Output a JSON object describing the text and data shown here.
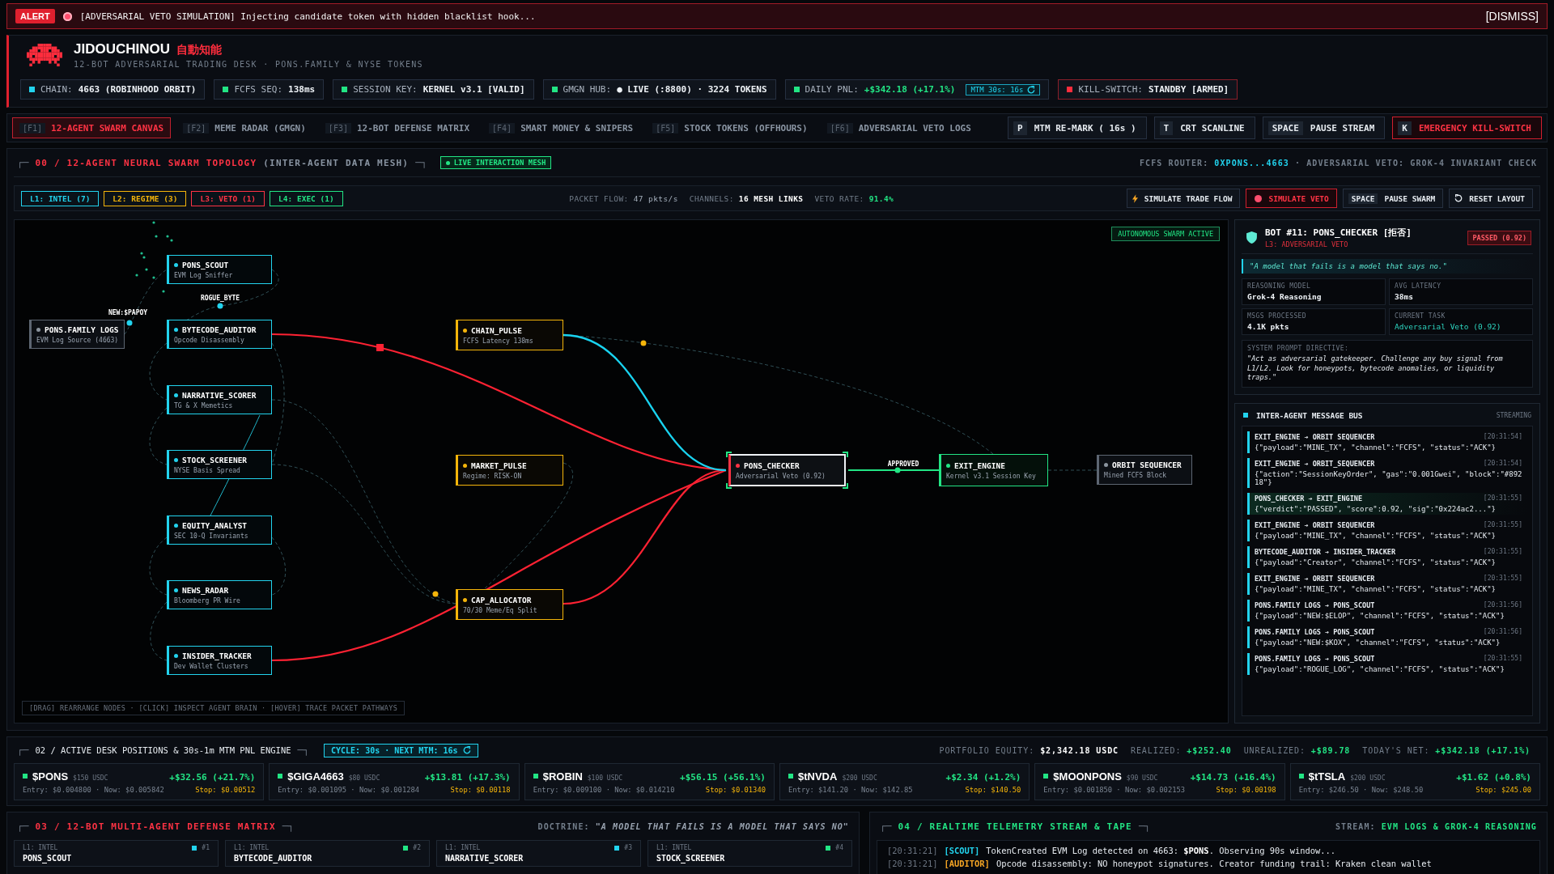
{
  "alert": {
    "badge": "ALERT",
    "message": "[ADVERSARIAL VETO SIMULATION] Injecting candidate token with hidden blacklist hook...",
    "dismiss": "[DISMISS]"
  },
  "header": {
    "brand": "JIDOUCHINOU",
    "brand_jp": "自動知能",
    "subtitle": "12-BOT ADVERSARIAL TRADING DESK · PONS.FAMILY & NYSE TOKENS",
    "status": [
      {
        "kind": "status",
        "label": "CHAIN:",
        "value": "4663 (ROBINHOOD ORBIT)",
        "color": "#22d3ee"
      },
      {
        "kind": "status",
        "label": "FCFS SEQ:",
        "value": "138ms",
        "color": "#22e584"
      },
      {
        "kind": "status",
        "label": "SESSION KEY:",
        "value": "KERNEL v3.1 [VALID]",
        "color": "#22e584"
      },
      {
        "kind": "status",
        "label": "GMGN HUB:",
        "value": "● LIVE (:8800) · 3224 TOKENS",
        "color": "#22e584"
      },
      {
        "kind": "pnl",
        "label": "DAILY PNL:",
        "value": "+$342.18 (+17.1%)",
        "color": "#22e584",
        "timer": "MTM 30s: 16s"
      },
      {
        "kind": "alert",
        "label": "KILL-SWITCH:",
        "value": "STANDBY [ARMED]",
        "color": "#ff2d3d"
      }
    ]
  },
  "tabs": [
    {
      "key": "[F1]",
      "label": "12-AGENT SWARM CANVAS",
      "selected": true
    },
    {
      "key": "[F2]",
      "label": "MEME RADAR (GMGN)",
      "selected": false
    },
    {
      "key": "[F3]",
      "label": "12-BOT DEFENSE MATRIX",
      "selected": false
    },
    {
      "key": "[F4]",
      "label": "SMART MONEY & SNIPERS",
      "selected": false
    },
    {
      "key": "[F5]",
      "label": "STOCK TOKENS (OFFHOURS)",
      "selected": false
    },
    {
      "key": "[F6]",
      "label": "ADVERSARIAL VETO LOGS",
      "selected": false
    }
  ],
  "actions": [
    {
      "kind": "normal",
      "key": "P",
      "label": "MTM RE-MARK ( 16s )"
    },
    {
      "kind": "normal",
      "key": "T",
      "label": "CRT SCANLINE"
    },
    {
      "kind": "normal",
      "key": "SPACE",
      "label": "PAUSE STREAM"
    },
    {
      "kind": "danger",
      "key": "K",
      "label": "EMERGENCY KILL-SWITCH"
    }
  ],
  "swarm": {
    "bracket_open": "┌─",
    "title": "00 / 12-AGENT NEURAL SWARM TOPOLOGY",
    "subtitle": "(INTER-AGENT DATA MESH)",
    "bracket_close": "─┐",
    "live_badge": "LIVE INTERACTION MESH",
    "router_label": "FCFS ROUTER:",
    "router_value": "0XPONS...4663",
    "router_note": "· ADVERSARIAL VETO: GROK-4 INVARIANT CHECK",
    "layers": [
      {
        "label": "L1: INTEL (7)",
        "color": "#22d3ee"
      },
      {
        "label": "L2: REGIME (3)",
        "color": "#f5b50a"
      },
      {
        "label": "L3: VETO (1)",
        "color": "#ff3344"
      },
      {
        "label": "L4: EXEC (1)",
        "color": "#22e584"
      }
    ],
    "stats": [
      {
        "kind": "plain",
        "label": "PACKET FLOW:",
        "value": "47 pkts/s"
      },
      {
        "kind": "strong",
        "label": "CHANNELS:",
        "value": "16 MESH LINKS"
      },
      {
        "kind": "good",
        "label": "VETO RATE:",
        "value": "91.4%"
      }
    ],
    "controls": [
      {
        "kind": "flow",
        "label": "SIMULATE TRADE FLOW"
      },
      {
        "kind": "veto",
        "label": "SIMULATE VETO"
      },
      {
        "kind": "pause",
        "key": "SPACE",
        "label": "PAUSE SWARM"
      },
      {
        "kind": "reset",
        "label": "RESET LAYOUT"
      }
    ],
    "canvas": {
      "status_badge": "AUTONOMOUS SWARM ACTIVE",
      "nodes": [
        {
          "kind": "source",
          "name": "PONS.FAMILY LOGS",
          "detail": "EVM Log Source (4663)",
          "selected": false
        },
        {
          "kind": "intel",
          "name": "PONS_SCOUT",
          "detail": "EVM Log Sniffer",
          "selected": false
        },
        {
          "kind": "intel",
          "name": "BYTECODE_AUDITOR",
          "detail": "Opcode Disassembly",
          "selected": false
        },
        {
          "kind": "intel",
          "name": "NARRATIVE_SCORER",
          "detail": "TG & X Memetics",
          "selected": false
        },
        {
          "kind": "intel",
          "name": "STOCK_SCREENER",
          "detail": "NYSE Basis Spread",
          "selected": false
        },
        {
          "kind": "intel",
          "name": "EQUITY_ANALYST",
          "detail": "SEC 10-Q Invariants",
          "selected": false
        },
        {
          "kind": "intel",
          "name": "NEWS_RADAR",
          "detail": "Bloomberg PR Wire",
          "selected": false
        },
        {
          "kind": "intel",
          "name": "INSIDER_TRACKER",
          "detail": "Dev Wallet Clusters",
          "selected": false
        },
        {
          "kind": "regime",
          "name": "CHAIN_PULSE",
          "detail": "FCFS Latency 138ms",
          "selected": false
        },
        {
          "kind": "regime",
          "name": "MARKET_PULSE",
          "detail": "Regime: RISK-ON",
          "selected": false
        },
        {
          "kind": "regime",
          "name": "CAP_ALLOCATOR",
          "detail": "70/30 Meme/Eq Split",
          "selected": false
        },
        {
          "kind": "veto",
          "name": "PONS_CHECKER",
          "detail": "Adversarial Veto (0.92)",
          "selected": true
        },
        {
          "kind": "exec",
          "name": "EXIT_ENGINE",
          "detail": "Kernel v3.1 Session Key",
          "selected": false
        },
        {
          "kind": "sink",
          "name": "ORBIT SEQUENCER",
          "detail": "Mined FCFS Block",
          "selected": false
        }
      ],
      "packets": [
        "NEW:$PAPOY",
        "ROGUE_BYTE",
        "APPROVED"
      ],
      "hint": "[DRAG] REARRANGE NODES · [CLICK] INSPECT AGENT BRAIN · [HOVER] TRACE PACKET PATHWAYS"
    }
  },
  "inspector": {
    "title": "BOT #11: PONS_CHECKER [拒否]",
    "layer": "L3: ADVERSARIAL VETO",
    "verdict": "PASSED (0.92)",
    "quote": "\"A model that fails is a model that says no.\"",
    "stats": [
      {
        "kind": "plain",
        "label": "REASONING MODEL",
        "value": "Grok-4 Reasoning"
      },
      {
        "kind": "plain",
        "label": "AVG LATENCY",
        "value": "38ms"
      },
      {
        "kind": "plain",
        "label": "MSGS PROCESSED",
        "value": "4.1K pkts"
      },
      {
        "kind": "accent",
        "label": "CURRENT TASK",
        "value": "Adversarial Veto (0.92)"
      }
    ],
    "directive_label": "SYSTEM PROMPT DIRECTIVE:",
    "directive": "\"Act as adversarial gatekeeper. Challenge any buy signal from L1/L2. Look for honeypots, bytecode anomalies, or liquidity traps.\""
  },
  "message_bus": {
    "title": "INTER-AGENT MESSAGE BUS",
    "status": "STREAMING",
    "messages": [
      {
        "route": "EXIT_ENGINE ➔ ORBIT SEQUENCER",
        "time": "[20:31:54]",
        "payload": "{\"payload\":\"MINE_TX\", \"channel\":\"FCFS\", \"status\":\"ACK\"}",
        "highlighted": false
      },
      {
        "route": "EXIT_ENGINE ➔ ORBIT_SEQUENCER",
        "time": "[20:31:54]",
        "payload": "{\"action\":\"SessionKeyOrder\", \"gas\":\"0.001Gwei\", \"block\":\"#89218\"}",
        "highlighted": false
      },
      {
        "route": "PONS_CHECKER ➔ EXIT_ENGINE",
        "time": "[20:31:55]",
        "payload": "{\"verdict\":\"PASSED\", \"score\":0.92, \"sig\":\"0x224ac2...\"}",
        "highlighted": true
      },
      {
        "route": "EXIT_ENGINE ➔ ORBIT SEQUENCER",
        "time": "[20:31:55]",
        "payload": "{\"payload\":\"MINE_TX\", \"channel\":\"FCFS\", \"status\":\"ACK\"}",
        "highlighted": false
      },
      {
        "route": "BYTECODE_AUDITOR ➔ INSIDER_TRACKER",
        "time": "[20:31:55]",
        "payload": "{\"payload\":\"Creator\", \"channel\":\"FCFS\", \"status\":\"ACK\"}",
        "highlighted": false
      },
      {
        "route": "EXIT_ENGINE ➔ ORBIT SEQUENCER",
        "time": "[20:31:55]",
        "payload": "{\"payload\":\"MINE_TX\", \"channel\":\"FCFS\", \"status\":\"ACK\"}",
        "highlighted": false
      },
      {
        "route": "PONS.FAMILY LOGS ➔ PONS_SCOUT",
        "time": "[20:31:56]",
        "payload": "{\"payload\":\"NEW:$ELOP\", \"channel\":\"FCFS\", \"status\":\"ACK\"}",
        "highlighted": false
      },
      {
        "route": "PONS.FAMILY LOGS ➔ PONS_SCOUT",
        "time": "[20:31:56]",
        "payload": "{\"payload\":\"NEW:$KOX\", \"channel\":\"FCFS\", \"status\":\"ACK\"}",
        "highlighted": false
      },
      {
        "route": "PONS.FAMILY LOGS ➔ PONS_SCOUT",
        "time": "[20:31:55]",
        "payload": "{\"payload\":\"ROGUE_LOG\", \"channel\":\"FCFS\", \"status\":\"ACK\"}",
        "highlighted": false
      }
    ]
  },
  "positions": {
    "bracket_open": "┌─",
    "title": "02 / ACTIVE DESK POSITIONS & 30s-1m MTM PNL ENGINE",
    "bracket_close": "─┐",
    "cycle": "CYCLE: 30s · NEXT MTM: 16s",
    "summary": [
      {
        "kind": "plain",
        "label": "PORTFOLIO EQUITY:",
        "value": "$2,342.18 USDC"
      },
      {
        "kind": "gain",
        "label": "REALIZED:",
        "value": "+$252.40"
      },
      {
        "kind": "gain",
        "label": "UNREALIZED:",
        "value": "+$89.78"
      },
      {
        "kind": "gain",
        "label": "TODAY'S NET:",
        "value": "+$342.18 (+17.1%)"
      }
    ],
    "items": [
      {
        "symbol": "$PONS",
        "size": "$150 USDC",
        "pnl": "+$32.56 (+21.7%)",
        "prices": "Entry: $0.004800 · Now: $0.005842",
        "stop": "Stop: $0.00512"
      },
      {
        "symbol": "$GIGA4663",
        "size": "$80 USDC",
        "pnl": "+$13.81 (+17.3%)",
        "prices": "Entry: $0.001095 · Now: $0.001284",
        "stop": "Stop: $0.00118"
      },
      {
        "symbol": "$ROBIN",
        "size": "$100 USDC",
        "pnl": "+$56.15 (+56.1%)",
        "prices": "Entry: $0.009100 · Now: $0.014210",
        "stop": "Stop: $0.01340"
      },
      {
        "symbol": "$tNVDA",
        "size": "$200 USDC",
        "pnl": "+$2.34 (+1.2%)",
        "prices": "Entry: $141.20 · Now: $142.85",
        "stop": "Stop: $140.50"
      },
      {
        "symbol": "$MOONPONS",
        "size": "$90 USDC",
        "pnl": "+$14.73 (+16.4%)",
        "prices": "Entry: $0.001850 · Now: $0.002153",
        "stop": "Stop: $0.00198"
      },
      {
        "symbol": "$tTSLA",
        "size": "$200 USDC",
        "pnl": "+$1.62 (+0.8%)",
        "prices": "Entry: $246.50 · Now: $248.50",
        "stop": "Stop: $245.00"
      }
    ]
  },
  "defense": {
    "bracket_open": "┌─",
    "title": "03 / 12-BOT MULTI-AGENT DEFENSE MATRIX",
    "bracket_close": "─┐",
    "doctrine_label": "DOCTRINE:",
    "doctrine": "\"A MODEL THAT FAILS IS A MODEL THAT SAYS NO\"",
    "bots": [
      {
        "layer": "L1: INTEL",
        "number": "#1",
        "name": "PONS_SCOUT",
        "color": "#22d3ee"
      },
      {
        "layer": "L1: INTEL",
        "number": "#2",
        "name": "BYTECODE_AUDITOR",
        "color": "#22e584"
      },
      {
        "layer": "L1: INTEL",
        "number": "#3",
        "name": "NARRATIVE_SCORER",
        "color": "#22d3ee"
      },
      {
        "layer": "L1: INTEL",
        "number": "#4",
        "name": "STOCK_SCREENER",
        "color": "#22e584"
      }
    ]
  },
  "telemetry": {
    "bracket_open": "┌─",
    "title": "04 / REALTIME TELEMETRY STREAM & TAPE",
    "bracket_close": "─┐",
    "stream_label": "STREAM:",
    "stream": "EVM LOGS & GROK-4 REASONING",
    "lines": [
      {
        "time": "[20:31:21]",
        "tag": "[SCOUT]",
        "color": "#22d3ee",
        "text": "TokenCreated EVM Log detected on 4663: **$PONS**. Observing 90s window..."
      },
      {
        "time": "[20:31:21]",
        "tag": "[AUDITOR]",
        "color": "#f5a524",
        "text": "Opcode disassembly: NO honeypot signatures. Creator funding trail: Kraken clean wallet"
      }
    ]
  }
}
